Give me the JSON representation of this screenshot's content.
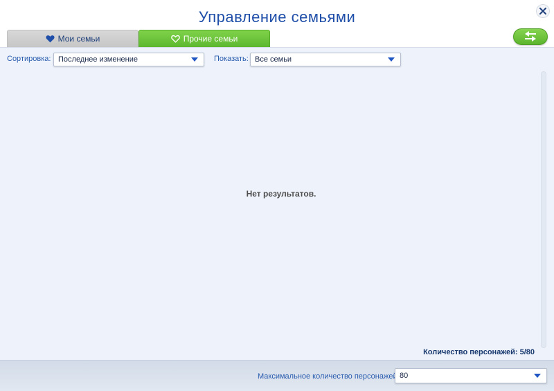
{
  "window": {
    "title": "Управление семьями"
  },
  "tabs": [
    {
      "label": "Мои семьи",
      "icon": "heart-filled-icon"
    },
    {
      "label": "Прочие семьи",
      "icon": "heart-outline-icon",
      "active": true
    }
  ],
  "filters": {
    "sort_label": "Сортировка:",
    "sort_value": "Последнее изменение",
    "show_label": "Показать:",
    "show_value": "Все семьи"
  },
  "results": {
    "empty_text": "Нет результатов."
  },
  "status": {
    "count_text": "Количество персонажей: 5/80"
  },
  "footer": {
    "max_label": "Максимальное количество персонажей:",
    "max_value": "80"
  },
  "colors": {
    "title_blue": "#1f4fa8",
    "accent_green": "#5db82f",
    "panel_bg": "#eef3fb"
  }
}
